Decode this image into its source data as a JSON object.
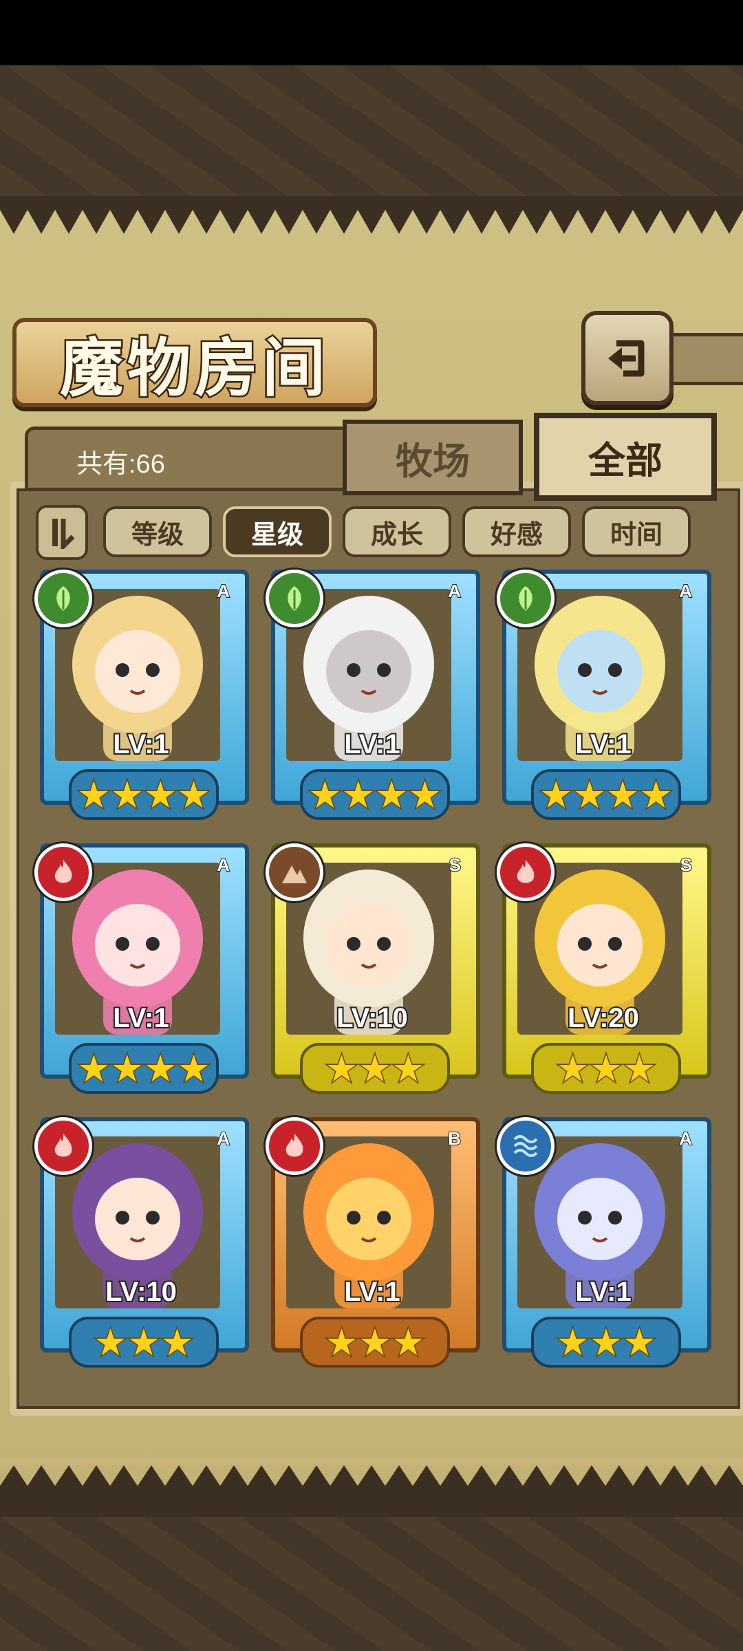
{
  "header": {
    "title": "魔物房间",
    "back_icon": "return-arrow-icon"
  },
  "summary": {
    "count_label": "共有:66"
  },
  "tabs": [
    {
      "label": "牧场",
      "active": false
    },
    {
      "label": "全部",
      "active": true
    }
  ],
  "sort": {
    "toggle_icon": "sort-order-icon",
    "options": [
      {
        "label": "等级",
        "active": false
      },
      {
        "label": "星级",
        "active": true
      },
      {
        "label": "成长",
        "active": false
      },
      {
        "label": "好感",
        "active": false
      },
      {
        "label": "时间",
        "active": false
      }
    ]
  },
  "monsters": [
    {
      "element": "grass",
      "element_icon": "leaf-icon",
      "rank": "A",
      "level": "LV:1",
      "stars": "★★★★",
      "star_count": 4,
      "hair": "#f3d58e",
      "skin": "#ffe9d6"
    },
    {
      "element": "grass",
      "element_icon": "leaf-icon",
      "rank": "A",
      "level": "LV:1",
      "stars": "★★★★",
      "star_count": 4,
      "hair": "#f2f2f2",
      "skin": "#cfc8c8"
    },
    {
      "element": "grass",
      "element_icon": "leaf-icon",
      "rank": "A",
      "level": "LV:1",
      "stars": "★★★★",
      "star_count": 4,
      "hair": "#f5e68e",
      "skin": "#bfe0f3"
    },
    {
      "element": "fire",
      "element_icon": "flame-icon",
      "rank": "A",
      "level": "LV:1",
      "stars": "★★★★",
      "star_count": 4,
      "hair": "#f07fb0",
      "skin": "#ffe3e3"
    },
    {
      "element": "earth",
      "element_icon": "mountain-icon",
      "rank": "S",
      "level": "LV:10",
      "stars": "★★★",
      "star_count": 3,
      "hair": "#f4ead6",
      "skin": "#ffe6d0"
    },
    {
      "element": "fire",
      "element_icon": "flame-icon",
      "rank": "S",
      "level": "LV:20",
      "stars": "★★★",
      "star_count": 3,
      "hair": "#f2c63a",
      "skin": "#ffe6d0"
    },
    {
      "element": "fire",
      "element_icon": "flame-icon",
      "rank": "A",
      "level": "LV:10",
      "stars": "★★★",
      "star_count": 3,
      "hair": "#7a4f9f",
      "skin": "#ffe6d6"
    },
    {
      "element": "fire",
      "element_icon": "flame-icon",
      "rank": "B",
      "level": "LV:1",
      "stars": "★★★",
      "star_count": 3,
      "hair": "#ff9a3a",
      "skin": "#ffd36a"
    },
    {
      "element": "water",
      "element_icon": "water-waves-icon",
      "rank": "A",
      "level": "LV:1",
      "stars": "★★★",
      "star_count": 3,
      "hair": "#7c7fd6",
      "skin": "#e7eaff"
    }
  ]
}
